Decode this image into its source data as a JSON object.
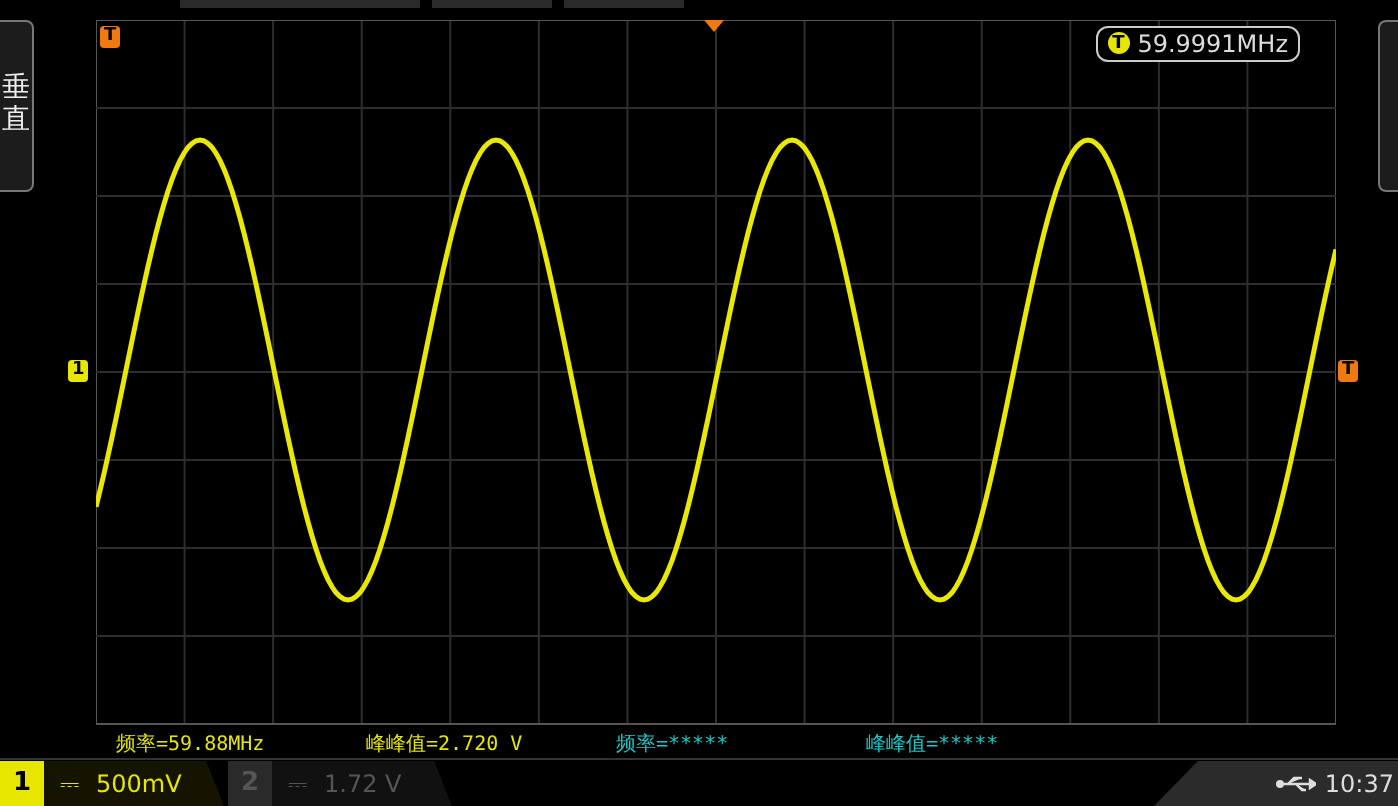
{
  "side_tab": {
    "label": "垂直"
  },
  "trigger_position": {
    "label": "T"
  },
  "trigger_frequency": {
    "icon_label": "T",
    "value": "59.9991MHz"
  },
  "channel_marker": {
    "label": "1"
  },
  "trigger_level_marker": {
    "label": "T"
  },
  "measurements": [
    {
      "text": "频率=59.88MHz",
      "color": "#e6e600"
    },
    {
      "text": "峰峰值=2.720 V",
      "color": "#e6e600"
    },
    {
      "text": "频率=*****",
      "color": "#19c8c8"
    },
    {
      "text": "峰峰值=*****",
      "color": "#19c8c8"
    }
  ],
  "channels": [
    {
      "number": "1",
      "coupling": "⎓",
      "scale": "500mV",
      "selected": true
    },
    {
      "number": "2",
      "coupling": "⎓",
      "scale": "1.72 V",
      "selected": false
    }
  ],
  "status": {
    "time": "10:37"
  }
}
